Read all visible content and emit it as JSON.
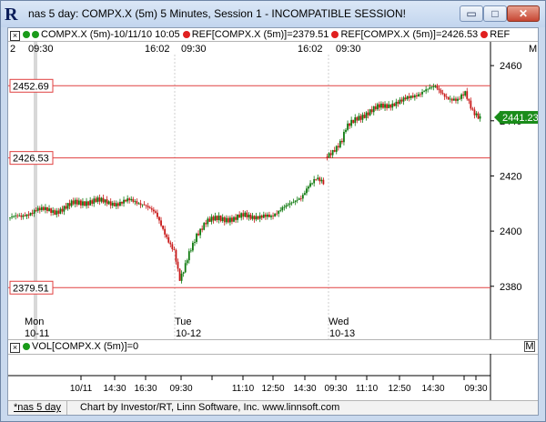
{
  "window": {
    "title": "nas 5 day: COMPX.X (5m) 5 Minutes, Session 1 - INCOMPATIBLE SESSION!",
    "logo": "R",
    "controls": {
      "minimize": "▭",
      "maximize": "□",
      "close": "✕"
    }
  },
  "legend": {
    "series": "COMPX.X (5m)-10/11/10 10:05",
    "ref1": "REF[COMPX.X (5m)]=2379.51",
    "ref2": "REF[COMPX.X (5m)]=2426.53",
    "ref3": "REF",
    "maximize_label": "M"
  },
  "volume_legend": {
    "text": "VOL[COMPX.X (5m)]=0",
    "maximize_label": "M"
  },
  "time_header": [
    "2",
    "09:30",
    "16:02",
    "09:30",
    "16:02",
    "09:30"
  ],
  "days": [
    {
      "name": "Mon",
      "date": "10-11"
    },
    {
      "name": "Tue",
      "date": "10-12"
    },
    {
      "name": "Wed",
      "date": "10-13"
    }
  ],
  "ref_labels": [
    "2452.69",
    "2426.53",
    "2379.51"
  ],
  "last_price": "2441.23",
  "footer": {
    "tab": "*nas 5 day",
    "credit": "Chart by Investor/RT, Linn Software, Inc. www.linnsoft.com"
  },
  "colors": {
    "up": "#0f7a0f",
    "down": "#c81818",
    "ref_line": "#e04040",
    "last_price_bg": "#1a8c1a"
  },
  "chart_data": {
    "type": "candlestick",
    "ylim": [
      2373,
      2464
    ],
    "y_ticks": [
      2380,
      2400,
      2420,
      2440,
      2460
    ],
    "ref_levels": [
      2452.69,
      2426.53,
      2379.51
    ],
    "last_price": 2441.23,
    "x_ticks": [
      "10/11",
      "14:30",
      "16:30",
      "09:30",
      "11:10",
      "12:50",
      "14:30",
      "09:30",
      "11:10",
      "12:50",
      "14:30",
      "09:30"
    ],
    "path": [
      [
        0,
        2405
      ],
      [
        6,
        2405
      ],
      [
        14,
        2408
      ],
      [
        24,
        2407
      ],
      [
        34,
        2410
      ],
      [
        46,
        2411
      ],
      [
        58,
        2410
      ],
      [
        64,
        2411
      ],
      [
        72,
        2410
      ],
      [
        78,
        2406
      ],
      [
        84,
        2398
      ],
      [
        88,
        2393
      ],
      [
        91,
        2382
      ],
      [
        93,
        2385
      ],
      [
        96,
        2392
      ],
      [
        100,
        2399
      ],
      [
        105,
        2403
      ],
      [
        112,
        2405
      ],
      [
        120,
        2404
      ],
      [
        126,
        2406
      ],
      [
        134,
        2405
      ],
      [
        140,
        2405
      ],
      [
        146,
        2409
      ],
      [
        152,
        2410
      ],
      [
        156,
        2412
      ],
      [
        160,
        2417
      ],
      [
        164,
        2419
      ],
      [
        168,
        2417
      ],
      [
        170,
        2427
      ],
      [
        174,
        2430
      ],
      [
        178,
        2433
      ],
      [
        180,
        2437
      ],
      [
        186,
        2441
      ],
      [
        192,
        2443
      ],
      [
        198,
        2445
      ],
      [
        204,
        2446
      ],
      [
        210,
        2447
      ],
      [
        216,
        2449
      ],
      [
        222,
        2451
      ],
      [
        228,
        2452
      ],
      [
        232,
        2450
      ],
      [
        236,
        2448
      ],
      [
        240,
        2447
      ],
      [
        244,
        2450
      ],
      [
        248,
        2444
      ],
      [
        252,
        2441
      ]
    ]
  }
}
